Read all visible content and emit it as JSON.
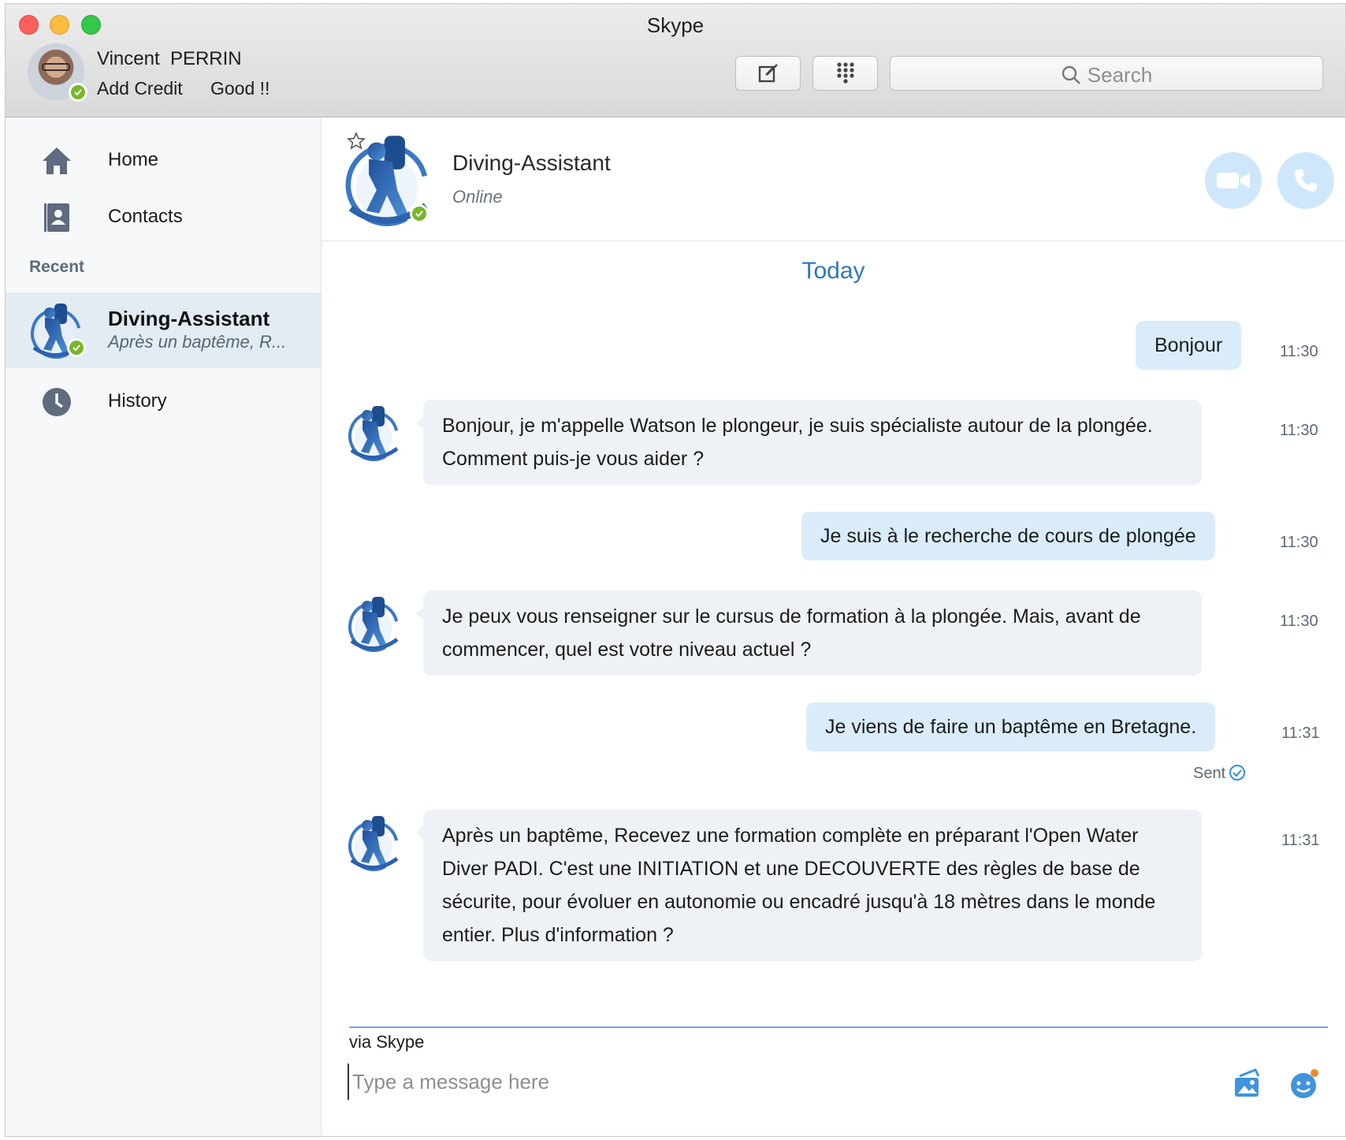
{
  "window": {
    "title": "Skype"
  },
  "profile": {
    "name": "Vincent  PERRIN",
    "add_credit": "Add Credit",
    "mood": "Good !!",
    "status": "online"
  },
  "toolbar": {
    "compose_icon": "compose-icon",
    "dialpad_icon": "dialpad-icon"
  },
  "search": {
    "placeholder": "Search"
  },
  "sidebar": {
    "nav": [
      {
        "label": "Home",
        "icon": "home-icon"
      },
      {
        "label": "Contacts",
        "icon": "contacts-icon"
      }
    ],
    "recent_heading": "Recent",
    "recent": [
      {
        "name": "Diving-Assistant",
        "preview": "Après un baptême, R...",
        "status": "online"
      }
    ],
    "history": {
      "label": "History",
      "icon": "clock-icon"
    }
  },
  "chat": {
    "contact_name": "Diving-Assistant",
    "contact_status": "Online",
    "date_divider": "Today",
    "messages": [
      {
        "direction": "out",
        "text": "Bonjour",
        "time": "11:30"
      },
      {
        "direction": "in",
        "text": "Bonjour, je m'appelle Watson le plongeur, je suis spécialiste autour de la plongée. Comment puis-je vous aider ?",
        "time": "11:30"
      },
      {
        "direction": "out",
        "text": "Je suis à le recherche de cours de plongée",
        "time": "11:30"
      },
      {
        "direction": "in",
        "text": "Je peux vous renseigner sur le cursus de formation à la plongée. Mais, avant de commencer, quel est votre niveau actuel ?",
        "time": "11:30"
      },
      {
        "direction": "out",
        "text": "Je viens de faire un baptême en Bretagne.",
        "time": "11:31",
        "receipt": "Sent"
      },
      {
        "direction": "in",
        "text": "Après un baptême, Recevez une formation complète en préparant l'Open Water Diver PADI. C'est une INITIATION et une DECOUVERTE des règles de base de sécurite, pour évoluer en autonomie ou encadré jusqu'à 18 mètres dans le monde entier. Plus d'information ?",
        "time": "11:31"
      }
    ]
  },
  "composer": {
    "via": "via Skype",
    "placeholder": "Type a message here",
    "media_icon": "media-gallery-icon",
    "emoji_icon": "emoji-icon"
  },
  "colors": {
    "accent": "#2f77b8",
    "online": "#77b72a",
    "outgoing_bubble": "#daecfa",
    "incoming_bubble": "#eef2f6",
    "selected_row": "#e3ebf3"
  }
}
